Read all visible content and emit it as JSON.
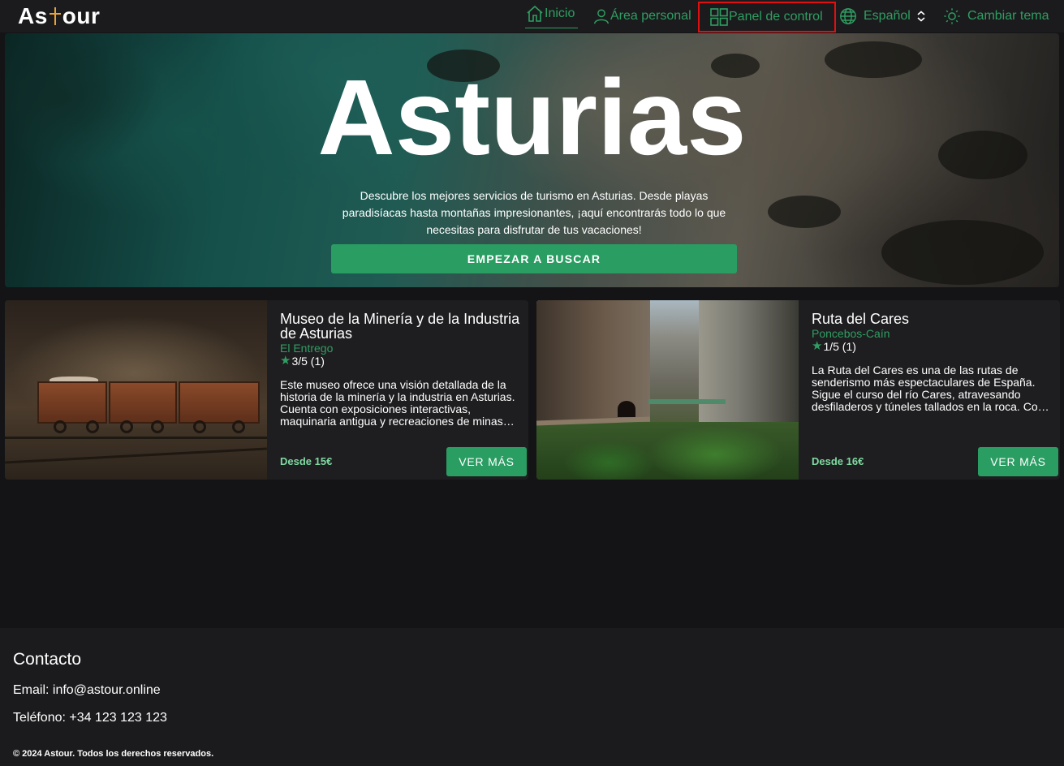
{
  "navbar": {
    "logo": {
      "left": "As",
      "right": "our"
    },
    "items": [
      {
        "label": "Inicio",
        "icon": "home-icon"
      },
      {
        "label": "Área personal",
        "icon": "user-icon"
      },
      {
        "label": "Panel de control",
        "icon": "grid-icon"
      },
      {
        "label": "Español",
        "icon": "globe-icon"
      },
      {
        "label": "Cambiar tema",
        "icon": "sun-icon"
      }
    ]
  },
  "hero": {
    "title": "Asturias",
    "description": "Descubre los mejores servicios de turismo en Asturias. Desde playas paradisíacas hasta montañas impresionantes, ¡aquí encontrarás todo lo que necesitas para disfrutar de tus vacaciones!",
    "button": "EMPEZAR A BUSCAR"
  },
  "cards": [
    {
      "title": "Museo de la Minería y de la Industria de Asturias",
      "location": "El Entrego",
      "rating": "3/5 (1)",
      "description": "Este museo ofrece una visión detallada de la historia de la minería y la industria en Asturias. Cuenta con exposiciones interactivas, maquinaria antigua y recreaciones de minas…",
      "price": "Desde 15€",
      "button": "VER MÁS"
    },
    {
      "title": "Ruta del Cares",
      "location": "Poncebos-Caín",
      "rating": "1/5 (1)",
      "description": "La Ruta del Cares es una de las rutas de senderismo más espectaculares de España. Sigue el curso del río Cares, atravesando desfiladeros y túneles tallados en la roca. Co…",
      "price": "Desde 16€",
      "button": "VER MÁS"
    }
  ],
  "footer": {
    "title": "Contacto",
    "email": "Email: info@astour.online",
    "phone": "Teléfono: +34 123 123 123",
    "copyright": "© 2024 Astour. Todos los derechos reservados."
  },
  "colors": {
    "accent": "#2a9d62",
    "highlight_border": "#e01010",
    "background": "#141416"
  }
}
